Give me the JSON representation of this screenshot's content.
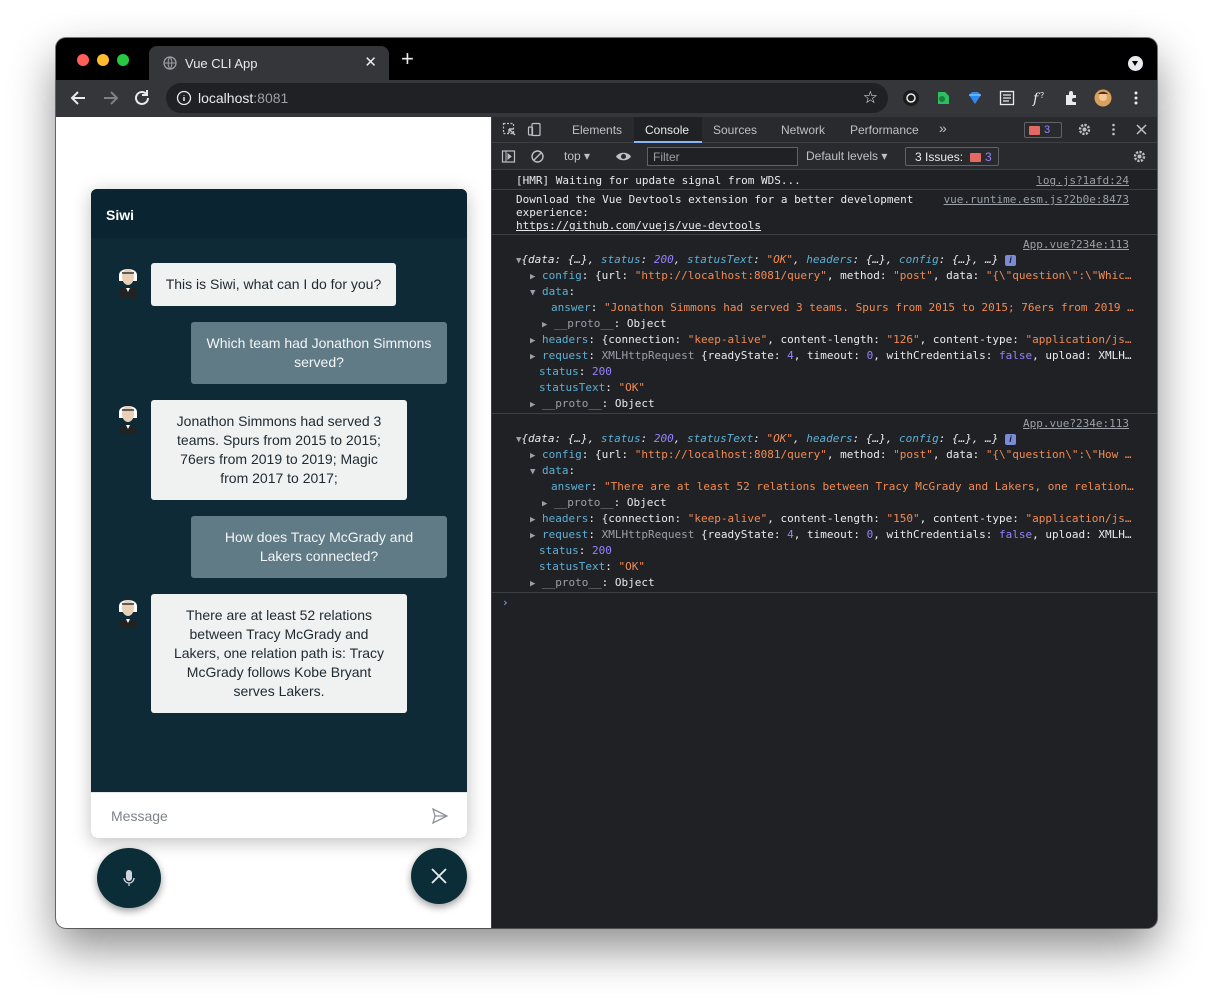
{
  "browser": {
    "tab_title": "Vue CLI App",
    "url_host": "localhost",
    "url_port": ":8081"
  },
  "chat": {
    "title": "Siwi",
    "messages": [
      {
        "role": "bot",
        "text": "This is Siwi, what can I do for you?"
      },
      {
        "role": "user",
        "text": "Which team had Jonathon Simmons served?"
      },
      {
        "role": "bot",
        "text": "Jonathon Simmons had served 3 teams. Spurs from 2015 to 2015; 76ers from 2019 to 2019; Magic from 2017 to 2017;"
      },
      {
        "role": "user",
        "text": "How does Tracy McGrady and Lakers connected?"
      },
      {
        "role": "bot",
        "text": "There are at least 52 relations between Tracy McGrady and Lakers, one relation path is: Tracy McGrady follows Kobe Bryant serves Lakers."
      }
    ],
    "input_placeholder": "Message",
    "colors": {
      "panel": "#0e2a36",
      "bot_bubble": "#f0f1f1",
      "user_bubble": "#607b86"
    }
  },
  "devtools": {
    "tabs": [
      "Elements",
      "Console",
      "Sources",
      "Network",
      "Performance"
    ],
    "more": "»",
    "active_tab": "Console",
    "error_count": "3",
    "context": "top ▾",
    "filter_placeholder": "Filter",
    "levels": "Default levels ▾",
    "issues_label": "3 Issues:",
    "issues_count": "3",
    "console": {
      "hmr": "[HMR] Waiting for update signal from WDS...",
      "hmr_src": "log.js?1afd:24",
      "devtools_msg_1": "Download the Vue Devtools extension for a better development",
      "devtools_msg_2": "experience:",
      "devtools_link": "https://github.com/vuejs/vue-devtools",
      "devtools_src": "vue.runtime.esm.js?2b0e:8473",
      "app_src": "App.vue?234e:113",
      "url": "\"http://localhost:8081/query\"",
      "method": "\"post\"",
      "data_q1": "\"{\\\"question\\\":\\\"Whic…",
      "data_q2": "\"{\\\"question\\\":\\\"How …",
      "answer1": "\"Jonathon Simmons had served 3 teams. Spurs from 2015 to 2015; 76ers from 2019 …",
      "answer2": "\"There are at least 52 relations between Tracy McGrady and Lakers, one relation…",
      "content_length1": "\"126\"",
      "content_length2": "\"150\"",
      "status": "200",
      "status_text": "\"OK\""
    }
  }
}
